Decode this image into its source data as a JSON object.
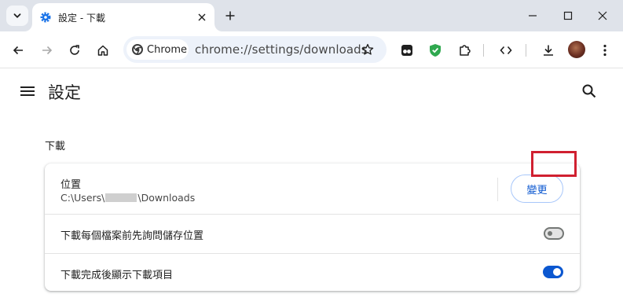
{
  "browser": {
    "tab": {
      "title": "設定 - 下載",
      "favicon": "gear-icon"
    },
    "omnibox": {
      "chip_label": "Chrome",
      "url": "chrome://settings/downloads"
    }
  },
  "settings": {
    "page_title": "設定",
    "section_title": "下載",
    "location": {
      "label": "位置",
      "path_prefix": "C:\\Users\\",
      "path_suffix": "\\Downloads",
      "change_button": "變更"
    },
    "rows": [
      {
        "label": "下載每個檔案前先詢問儲存位置",
        "enabled": false
      },
      {
        "label": "下載完成後顯示下載項目",
        "enabled": true
      }
    ]
  },
  "colors": {
    "accent": "#0b57d0",
    "highlight": "#d02030",
    "tabstrip": "#dfe3ea"
  }
}
